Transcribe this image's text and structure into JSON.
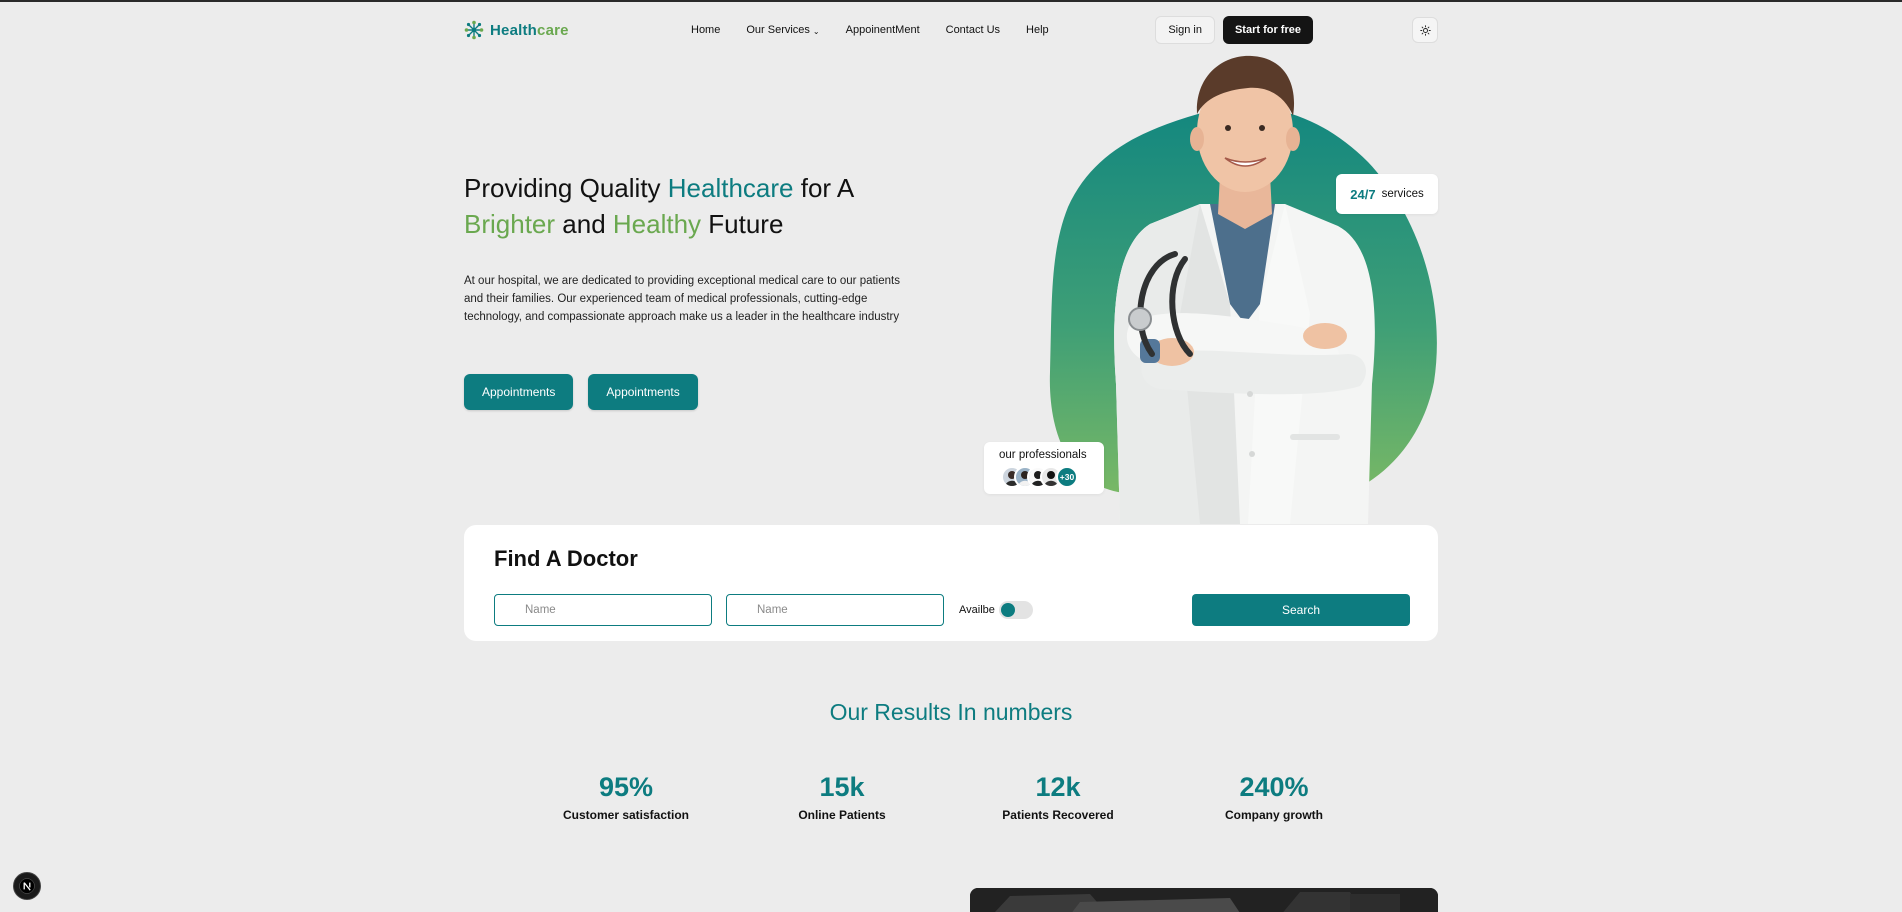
{
  "brand": {
    "part1": "Health",
    "part2": "care"
  },
  "nav": {
    "links": [
      "Home",
      "Our Services",
      "AppoinentMent",
      "Contact Us",
      "Help"
    ],
    "sign_in": "Sign in",
    "start_free": "Start for free"
  },
  "hero": {
    "title_1": "Providing Quality ",
    "title_2": "Healthcare",
    "title_3": " for A",
    "title_4": "Brighter",
    "title_5": " and ",
    "title_6": "Healthy",
    "title_7": " Future",
    "description": "At our hospital, we are dedicated to providing exceptional medical care to our patients and their families. Our experienced team of medical professionals, cutting-edge technology, and compassionate approach make us a leader in the healthcare industry",
    "button_1": "Appointments",
    "button_2": "Appointments"
  },
  "badges": {
    "services_num": "24/7",
    "services_txt": "services",
    "professionals": "our professionals",
    "more_count": "+30"
  },
  "find_doctor": {
    "title": "Find A Doctor",
    "field_1_placeholder": "Name",
    "field_2_placeholder": "Name",
    "available_label": "Availbe",
    "search": "Search"
  },
  "results": {
    "title": "Our Results In numbers",
    "stats": [
      {
        "value": "95%",
        "label": "Customer satisfaction"
      },
      {
        "value": "15k",
        "label": "Online Patients"
      },
      {
        "value": "12k",
        "label": "Patients Recovered"
      },
      {
        "value": "240%",
        "label": "Company growth"
      }
    ]
  },
  "colors": {
    "accent": "#0d7c80",
    "green": "#6aa84f",
    "dark": "#141414",
    "bg": "#ececec"
  },
  "icons": [
    "logo-tree-icon",
    "chevron-down-icon",
    "sun-icon",
    "next-logo-icon"
  ]
}
